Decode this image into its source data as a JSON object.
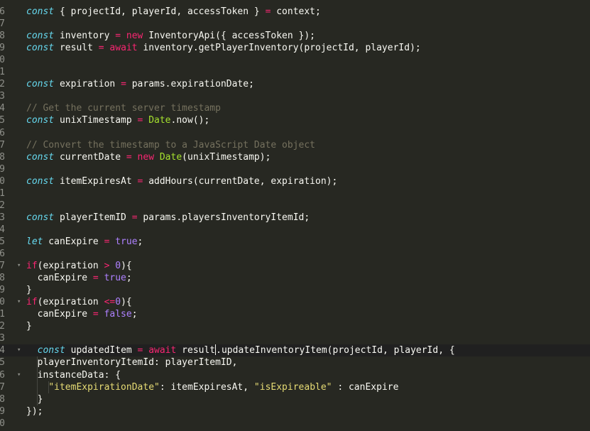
{
  "editor": {
    "theme_colors": {
      "background": "#272822",
      "keyword": "#66d9ef",
      "control": "#f92672",
      "function": "#a6e22e",
      "string": "#e6db74",
      "constant": "#ae81ff",
      "comment": "#75715e"
    },
    "gutter_numbers": [
      "6",
      "7",
      "8",
      "9",
      "0",
      "1",
      "2",
      "3",
      "4",
      "5",
      "6",
      "7",
      "8",
      "9",
      "0",
      "1",
      "2",
      "3",
      "4",
      "5",
      "6",
      "7",
      "8",
      "9",
      "0",
      "1",
      "2",
      "3",
      "4",
      "5",
      "6",
      "7",
      "8",
      "9",
      "0"
    ],
    "lines": [
      {
        "tokens": [
          [
            "kw",
            "const"
          ],
          [
            "plain",
            " { projectId, playerId, accessToken } "
          ],
          [
            "op",
            "="
          ],
          [
            "plain",
            " context;"
          ]
        ]
      },
      {
        "tokens": []
      },
      {
        "tokens": [
          [
            "kw",
            "const"
          ],
          [
            "plain",
            " inventory "
          ],
          [
            "op",
            "="
          ],
          [
            "plain",
            " "
          ],
          [
            "ctl",
            "new"
          ],
          [
            "plain",
            " InventoryApi({ accessToken });"
          ]
        ]
      },
      {
        "tokens": [
          [
            "kw",
            "const"
          ],
          [
            "plain",
            " result "
          ],
          [
            "op",
            "="
          ],
          [
            "plain",
            " "
          ],
          [
            "ctl",
            "await"
          ],
          [
            "plain",
            " inventory.getPlayerInventory(projectId, playerId);"
          ]
        ]
      },
      {
        "tokens": []
      },
      {
        "tokens": []
      },
      {
        "tokens": [
          [
            "kw",
            "const"
          ],
          [
            "plain",
            " expiration "
          ],
          [
            "op",
            "="
          ],
          [
            "plain",
            " params.expirationDate;"
          ]
        ]
      },
      {
        "tokens": []
      },
      {
        "tokens": [
          [
            "cmt",
            "// Get the current server timestamp"
          ]
        ]
      },
      {
        "tokens": [
          [
            "kw",
            "const"
          ],
          [
            "plain",
            " unixTimestamp "
          ],
          [
            "op",
            "="
          ],
          [
            "plain",
            " "
          ],
          [
            "fn",
            "Date"
          ],
          [
            "plain",
            ".now();"
          ]
        ]
      },
      {
        "tokens": []
      },
      {
        "tokens": [
          [
            "cmt",
            "// Convert the timestamp to a JavaScript Date object"
          ]
        ]
      },
      {
        "tokens": [
          [
            "kw",
            "const"
          ],
          [
            "plain",
            " currentDate "
          ],
          [
            "op",
            "="
          ],
          [
            "plain",
            " "
          ],
          [
            "ctl",
            "new"
          ],
          [
            "plain",
            " "
          ],
          [
            "fn",
            "Date"
          ],
          [
            "plain",
            "(unixTimestamp);"
          ]
        ]
      },
      {
        "tokens": []
      },
      {
        "tokens": [
          [
            "kw",
            "const"
          ],
          [
            "plain",
            " itemExpiresAt "
          ],
          [
            "op",
            "="
          ],
          [
            "plain",
            " addHours(currentDate, expiration);"
          ]
        ]
      },
      {
        "tokens": []
      },
      {
        "tokens": []
      },
      {
        "tokens": [
          [
            "kw",
            "const"
          ],
          [
            "plain",
            " playerItemID "
          ],
          [
            "op",
            "="
          ],
          [
            "plain",
            " params.playersInventoryItemId;"
          ]
        ]
      },
      {
        "tokens": []
      },
      {
        "tokens": [
          [
            "kw",
            "let"
          ],
          [
            "plain",
            " canExpire "
          ],
          [
            "op",
            "="
          ],
          [
            "plain",
            " "
          ],
          [
            "bool",
            "true"
          ],
          [
            "plain",
            ";"
          ]
        ]
      },
      {
        "tokens": []
      },
      {
        "fold": true,
        "tokens": [
          [
            "ctl",
            "if"
          ],
          [
            "plain",
            "(expiration "
          ],
          [
            "op",
            ">"
          ],
          [
            "plain",
            " "
          ],
          [
            "num",
            "0"
          ],
          [
            "plain",
            "){"
          ]
        ]
      },
      {
        "tokens": [
          [
            "plain",
            "  canExpire "
          ],
          [
            "op",
            "="
          ],
          [
            "plain",
            " "
          ],
          [
            "bool",
            "true"
          ],
          [
            "plain",
            ";"
          ]
        ]
      },
      {
        "tokens": [
          [
            "plain",
            "}"
          ]
        ]
      },
      {
        "fold": true,
        "tokens": [
          [
            "ctl",
            "if"
          ],
          [
            "plain",
            "(expiration "
          ],
          [
            "op",
            "<="
          ],
          [
            "num",
            "0"
          ],
          [
            "plain",
            "){"
          ]
        ]
      },
      {
        "tokens": [
          [
            "plain",
            "  canExpire "
          ],
          [
            "op",
            "="
          ],
          [
            "plain",
            " "
          ],
          [
            "bool",
            "false"
          ],
          [
            "plain",
            ";"
          ]
        ]
      },
      {
        "tokens": [
          [
            "plain",
            "}"
          ]
        ]
      },
      {
        "tokens": []
      },
      {
        "fold": true,
        "active": true,
        "cursor_after": "  const updatedItem = await result",
        "tokens": [
          [
            "plain",
            "  "
          ],
          [
            "kw",
            "const"
          ],
          [
            "plain",
            " updatedItem "
          ],
          [
            "op",
            "="
          ],
          [
            "plain",
            " "
          ],
          [
            "ctl",
            "await"
          ],
          [
            "plain",
            " result"
          ],
          [
            "cursor",
            ""
          ],
          [
            "plain",
            ".updateInventoryItem(projectId, playerId, {"
          ]
        ]
      },
      {
        "tokens": [
          [
            "plain",
            "  playerInventoryItemId: playerItemID,"
          ]
        ]
      },
      {
        "fold": true,
        "tokens": [
          [
            "plain",
            "  instanceData: {"
          ]
        ]
      },
      {
        "tokens": [
          [
            "plain",
            "    "
          ],
          [
            "str",
            "\"itemExpirationDate\""
          ],
          [
            "plain",
            ": itemExpiresAt, "
          ],
          [
            "str",
            "\"isExpireable\""
          ],
          [
            "plain",
            " : canExpire"
          ]
        ]
      },
      {
        "tokens": [
          [
            "plain",
            "  }"
          ]
        ]
      },
      {
        "tokens": [
          [
            "plain",
            "});"
          ]
        ]
      },
      {
        "tokens": []
      }
    ]
  }
}
